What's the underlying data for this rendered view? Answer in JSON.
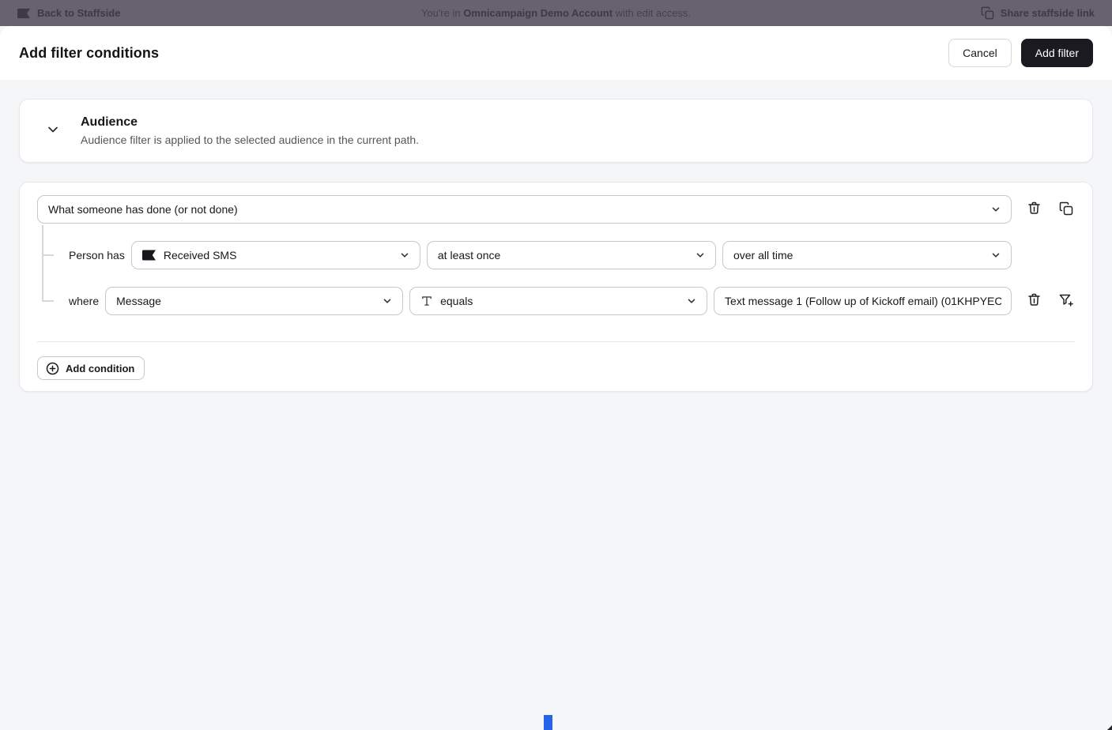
{
  "top_bar": {
    "back_label": "Back to Staffside",
    "center_prefix": "You're in ",
    "center_account": "Omnicampaign Demo Account",
    "center_suffix": " with edit access.",
    "share_label": "Share staffside link"
  },
  "header": {
    "title": "Add filter conditions",
    "cancel_label": "Cancel",
    "add_filter_label": "Add filter"
  },
  "audience_section": {
    "title": "Audience",
    "description": "Audience filter is applied to the selected audience in the current path."
  },
  "filter_card": {
    "condition_type": "What someone has done (or not done)",
    "event_row": {
      "label": "Person has",
      "event": "Received SMS",
      "frequency": "at least once",
      "timeframe": "over all time"
    },
    "where_row": {
      "label": "where",
      "field": "Message",
      "operator": "equals",
      "value": "Text message 1 (Follow up of Kickoff email) (01KHPYEC"
    },
    "add_condition_label": "Add condition"
  },
  "icons": {
    "back": "flag-icon",
    "share": "copy-icon",
    "audience_collapse": "chevron-down-icon",
    "condition_delete": "trash-icon",
    "condition_duplicate": "copy-icon",
    "event": "flag-icon",
    "operator_type": "text-type-icon",
    "where_delete": "trash-icon",
    "where_subfilter": "filter-plus-icon",
    "add_condition": "plus-circle-icon"
  },
  "colors": {
    "topbar_bg": "#68616F",
    "page_bg": "#F5F6F8",
    "card_bg": "#FFFFFF",
    "primary_button_bg": "#1A1A20",
    "control_border": "#C7C7CE",
    "blue_artifact": "#2563EB"
  }
}
